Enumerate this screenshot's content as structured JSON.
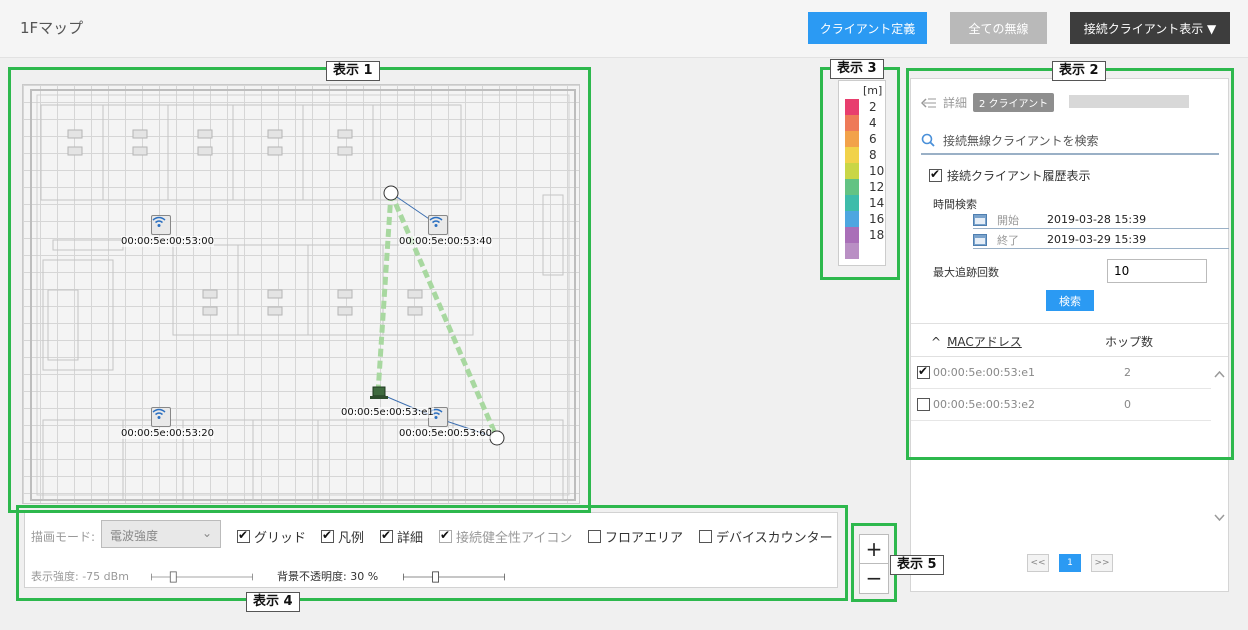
{
  "header": {
    "title": "1Fマップ",
    "define_client": "クライアント定義",
    "all_wireless": "全ての無線",
    "connected_clients": "接続クライアント表示 ▼"
  },
  "callouts": {
    "c1": "表示 1",
    "c2": "表示 2",
    "c3": "表示 3",
    "c4": "表示 4",
    "c5": "表示 5"
  },
  "map": {
    "access_points": [
      {
        "label": "00:00:5e:00:53:00"
      },
      {
        "label": "00:00:5e:00:53:40"
      },
      {
        "label": "00:00:5e:00:53:20"
      },
      {
        "label": "00:00:5e:00:53:60"
      }
    ],
    "client_label": "00:00:5e:00:53:e1"
  },
  "legend": {
    "unit": "[m]",
    "levels": [
      {
        "value": "2",
        "color": "#e83e6e"
      },
      {
        "value": "4",
        "color": "#ee7a58"
      },
      {
        "value": "6",
        "color": "#f2a24a"
      },
      {
        "value": "8",
        "color": "#f1d24a"
      },
      {
        "value": "10",
        "color": "#c9d646"
      },
      {
        "value": "12",
        "color": "#63c383"
      },
      {
        "value": "14",
        "color": "#3ebcaa"
      },
      {
        "value": "16",
        "color": "#4ea6e0"
      },
      {
        "value": "18",
        "color": "#a96fb8"
      }
    ]
  },
  "panel": {
    "detail": "詳細",
    "badge": "2 クライアント",
    "search_placeholder": "接続無線クライアントを検索",
    "history_label": "接続クライアント履歴表示",
    "time_search": "時間検索",
    "start_label": "開始",
    "start_value": "2019-03-28 15:39",
    "end_label": "終了",
    "end_value": "2019-03-29 15:39",
    "max_trace_label": "最大追跡回数",
    "max_trace_value": "10",
    "search_button": "検索",
    "col_mac": "MACアドレス",
    "col_hops": "ホップ数",
    "rows": [
      {
        "mac": "00:00:5e:00:53:e1",
        "hops": "2"
      },
      {
        "mac": "00:00:5e:00:53:e2",
        "hops": "0"
      }
    ],
    "pager": {
      "first": "<<",
      "current": "1",
      "next": ">>"
    }
  },
  "controls": {
    "mode_label": "描画モード:",
    "mode_value": "電波強度",
    "grid": "グリッド",
    "legend": "凡例",
    "detail": "詳細",
    "health_icon": "接続健全性アイコン",
    "floor_area": "フロアエリア",
    "device_counter": "デバイスカウンター",
    "strength_label": "表示強度: -75 dBm",
    "opacity_label": "背景不透明度: 30 %"
  },
  "zoom": {
    "plus": "+",
    "minus": "−"
  },
  "colors": {
    "accent": "#2b9af3",
    "frame": "#2db84d"
  }
}
